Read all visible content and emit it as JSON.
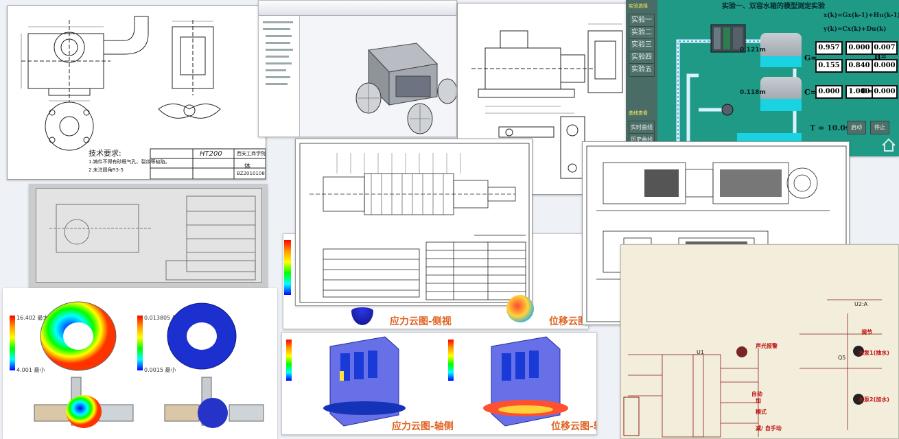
{
  "drawing_a": {
    "tech_req": "技术要求:",
    "note1": "1.铸件不得有砂眼气孔、裂纹等缺陷。",
    "note2": "2.未注圆角R3-5",
    "material": "HT200",
    "school": "西安工商学院",
    "sheet": "体",
    "code": "BZ2010108"
  },
  "captions": {
    "stress_side": "应力云图-侧视",
    "disp_side": "位移云图-",
    "stress_axis": "应力云图-轴侧",
    "disp_axis": "位移云图-轴侧"
  },
  "scada": {
    "title": "实验一、双容水箱的模型测定实验",
    "menu_header": "实验选择",
    "menu_items": [
      "实验一",
      "实验二",
      "实验三",
      "实验四",
      "实验五"
    ],
    "curve_header": "曲线查看",
    "curve_items": [
      "实时曲线",
      "历史曲线"
    ],
    "eq1": "x(k)=Gx(k-1)+Hu(k-1)",
    "eq2": "y(k)=Cx(k)+Du(k)",
    "level1": "0.121m",
    "level2": "0.118m",
    "G_label": "G=",
    "H_label": "H=",
    "C_label": "C=",
    "D_label": "D=",
    "G": [
      "0.957",
      "0.000",
      "0.155",
      "0.840"
    ],
    "H": [
      "0.007",
      "0.000"
    ],
    "C": [
      "0.000",
      "1.000"
    ],
    "D": [
      "0.000"
    ],
    "time": "T = 10.0s",
    "btn_start": "启动",
    "btn_stop": "停止"
  },
  "circuit": {
    "labels": [
      "声光报警",
      "水泵1(抽水)",
      "水泵2(加水)",
      "自动",
      "模式",
      "减/ 自手动",
      "调节",
      "加",
      "Q5",
      "U2:A"
    ],
    "chip": "U1"
  },
  "fea": {
    "legend_top": "16.402 最大",
    "legend_bottom": "4.001 最小",
    "legend2_top": "0.013805 最大",
    "legend2_bottom": "0.0015 最小"
  },
  "colors": {
    "scada_bg": "#1e9a86",
    "tank_water": "#19d2e2",
    "caption": "#e0611e"
  }
}
